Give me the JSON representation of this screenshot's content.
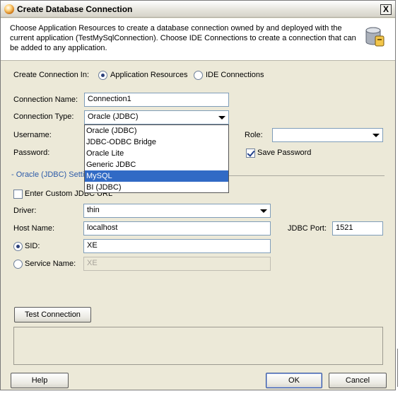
{
  "window": {
    "title": "Create Database Connection",
    "close_label": "X"
  },
  "info": {
    "text": "Choose Application Resources to create a database connection owned by and deployed with the current application (TestMySqlConnection). Choose IDE Connections to create a connection that can be added to any application."
  },
  "create_in": {
    "label": "Create Connection In:",
    "options": [
      "Application Resources",
      "IDE Connections"
    ],
    "selected": "Application Resources"
  },
  "connection_name": {
    "label": "Connection Name:",
    "value": "Connection1"
  },
  "connection_type": {
    "label": "Connection Type:",
    "value": "Oracle (JDBC)",
    "options": [
      "Oracle (JDBC)",
      "JDBC-ODBC Bridge",
      "Oracle Lite",
      "Generic JDBC",
      "MySQL",
      "BI (JDBC)"
    ],
    "highlighted": "MySQL"
  },
  "username": {
    "label": "Username:",
    "value": ""
  },
  "password": {
    "label": "Password:",
    "value": ""
  },
  "role": {
    "label": "Role:",
    "value": ""
  },
  "save_password": {
    "label": "Save Password",
    "checked": true
  },
  "settings": {
    "title_visible": "- Oracle (JDBC) Settin",
    "custom_url_label_visible": "Enter Custom JDBC URL",
    "custom_url_checked": false,
    "driver": {
      "label": "Driver:",
      "value": "thin"
    },
    "host": {
      "label": "Host Name:",
      "value": "localhost"
    },
    "port": {
      "label": "JDBC Port:",
      "value": "1521"
    },
    "sid": {
      "label": "SID:",
      "value": "XE",
      "selected": true
    },
    "service_name": {
      "label": "Service Name:",
      "value": "XE",
      "selected": false
    }
  },
  "buttons": {
    "test_connection": "Test Connection",
    "help": "Help",
    "ok": "OK",
    "cancel": "Cancel"
  }
}
